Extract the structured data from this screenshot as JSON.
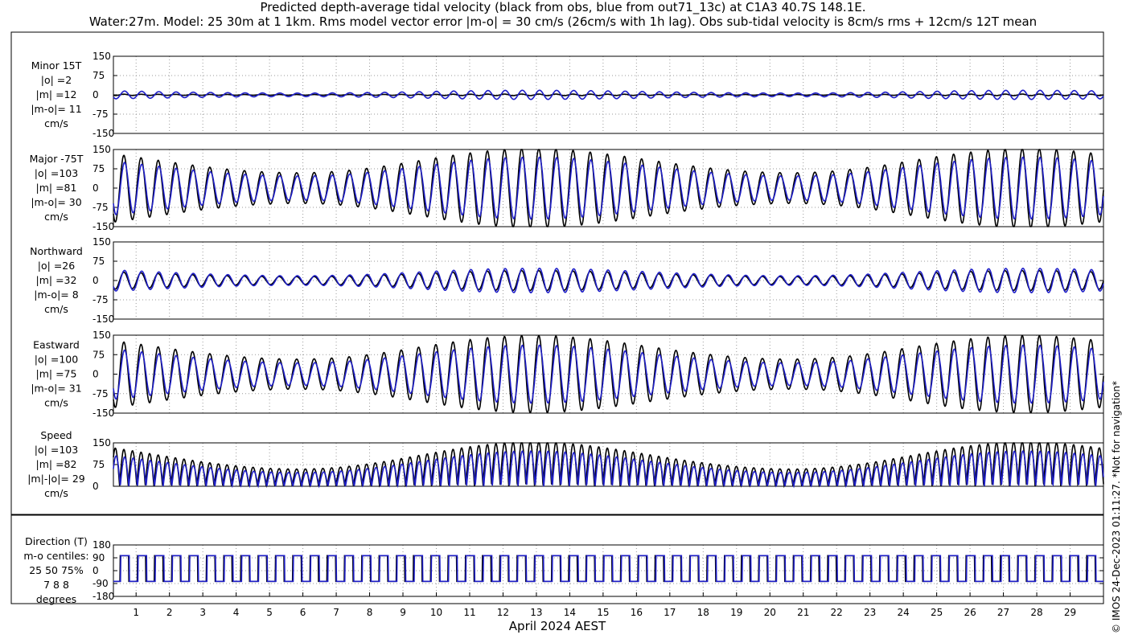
{
  "title": {
    "line1": "Predicted depth-average tidal velocity (black from obs, blue from out71_13c) at C1A3 40.7S 148.1E.",
    "line2": "Water:27m. Model: 25 30m at 1 1km. Rms model vector error |m-o| = 30 cm/s (26cm/s with 1h lag). Obs sub-tidal velocity is 8cm/s rms + 12cm/s 12T mean"
  },
  "stamp": "© IMOS 24-Dec-2023 01:11:27. *Not for navigation*",
  "colors": {
    "obs": "#000000",
    "model": "#1f1fc8",
    "grid": "#9a9a9a"
  },
  "chart_data": [
    {
      "type": "line",
      "panel": "minor",
      "label_lines": [
        "Minor 15T",
        "|o| =2",
        "|m| =12",
        "|m-o|= 11",
        "cm/s"
      ],
      "ylim": [
        -150,
        150
      ],
      "yticks": [
        150,
        75,
        0,
        -75,
        -150
      ],
      "series": [
        {
          "name": "obs",
          "amplitude": 2
        },
        {
          "name": "model",
          "amplitude": 12
        }
      ]
    },
    {
      "type": "line",
      "panel": "major",
      "label_lines": [
        "Major -75T",
        "|o| =103",
        "|m| =81",
        "|m-o|= 30",
        "cm/s"
      ],
      "ylim": [
        -150,
        150
      ],
      "yticks": [
        150,
        75,
        0,
        -75,
        -150
      ],
      "series": [
        {
          "name": "obs",
          "amplitude": 103
        },
        {
          "name": "model",
          "amplitude": 81
        }
      ]
    },
    {
      "type": "line",
      "panel": "northward",
      "label_lines": [
        "Northward",
        "|o| =26",
        "|m| =32",
        "|m-o|= 8",
        "cm/s"
      ],
      "ylim": [
        -150,
        150
      ],
      "yticks": [
        150,
        75,
        0,
        -75,
        -150
      ],
      "series": [
        {
          "name": "obs",
          "amplitude": 26
        },
        {
          "name": "model",
          "amplitude": 32
        }
      ]
    },
    {
      "type": "line",
      "panel": "eastward",
      "label_lines": [
        "Eastward",
        "|o| =100",
        "|m| =75",
        "|m-o|= 31",
        "cm/s"
      ],
      "ylim": [
        -150,
        150
      ],
      "yticks": [
        150,
        75,
        0,
        -75,
        -150
      ],
      "series": [
        {
          "name": "obs",
          "amplitude": 100
        },
        {
          "name": "model",
          "amplitude": 75
        }
      ]
    },
    {
      "type": "line",
      "panel": "speed",
      "label_lines": [
        "Speed",
        "|o| =103",
        "|m| =82",
        "|m|-|o|= 29",
        "cm/s"
      ],
      "ylim": [
        0,
        150
      ],
      "yticks": [
        150,
        75,
        0
      ],
      "series": [
        {
          "name": "obs",
          "amplitude": 103
        },
        {
          "name": "model",
          "amplitude": 82
        }
      ]
    },
    {
      "type": "line",
      "panel": "direction",
      "label_lines": [
        "Direction (T)",
        "m-o centiles:",
        "25  50  75%",
        "7   8   8",
        "degrees"
      ],
      "ylim": [
        -180,
        180
      ],
      "yticks": [
        180,
        90,
        0,
        -90,
        -180
      ],
      "series": [
        {
          "name": "obs",
          "high_deg": 105,
          "low_deg": -75
        },
        {
          "name": "model",
          "high_deg": 105,
          "low_deg": -75
        }
      ]
    }
  ],
  "x_axis": {
    "label": "April 2024 AEST",
    "tick_labels": [
      "1",
      "2",
      "3",
      "4",
      "5",
      "6",
      "7",
      "8",
      "9",
      "10",
      "11",
      "12",
      "13",
      "14",
      "15",
      "16",
      "17",
      "18",
      "19",
      "20",
      "21",
      "22",
      "23",
      "24",
      "25",
      "26",
      "27",
      "28",
      "29"
    ],
    "xlim_days": [
      0.32,
      30.0
    ]
  }
}
